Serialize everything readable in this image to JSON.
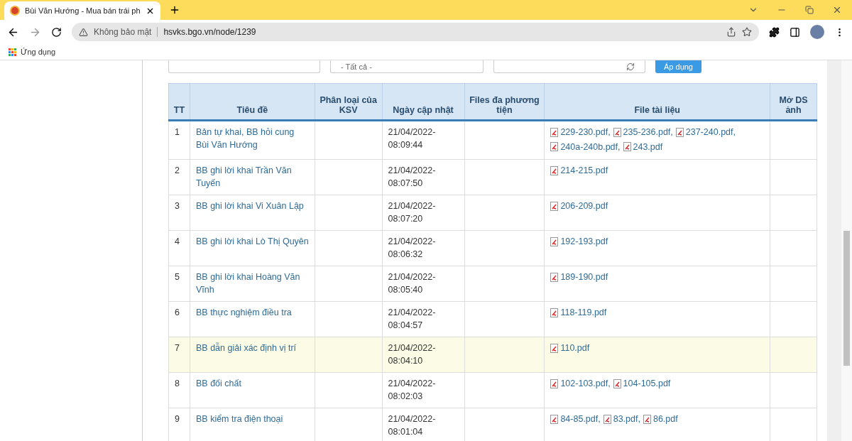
{
  "browser": {
    "tab_title": "Bùi Văn Hướng - Mua bán trái ph",
    "security_label": "Không bảo mật",
    "url": "hsvks.bgo.vn/node/1239",
    "bookmarks": [
      "Ứng dụng"
    ]
  },
  "filters": {
    "select_value": "- Tất cả -",
    "apply_button": "Áp dụng"
  },
  "table": {
    "columns": [
      "TT",
      "Tiêu đề",
      "Phân loại của KSV",
      "Ngày cập nhật",
      "Files đa phương tiện",
      "File tài liệu",
      "Mở DS ảnh"
    ],
    "rows": [
      {
        "tt": "1",
        "title": "Bản tự khai, BB hỏi cung Bùi Văn Hướng",
        "date": "21/04/2022-08:09:44",
        "files": [
          "229-230.pdf,",
          "235-236.pdf,",
          "237-240.pdf,",
          "240a-240b.pdf,",
          "243.pdf"
        ],
        "highlighted": false
      },
      {
        "tt": "2",
        "title": "BB ghi lời khai Trần Văn Tuyến",
        "date": "21/04/2022-08:07:50",
        "files": [
          "214-215.pdf"
        ],
        "highlighted": false
      },
      {
        "tt": "3",
        "title": "BB ghi lời khai Vi Xuân Lập",
        "date": "21/04/2022-08:07:20",
        "files": [
          "206-209.pdf"
        ],
        "highlighted": false
      },
      {
        "tt": "4",
        "title": "BB ghi lời khai Lò Thị Quyên",
        "date": "21/04/2022-08:06:32",
        "files": [
          "192-193.pdf"
        ],
        "highlighted": false
      },
      {
        "tt": "5",
        "title": "BB ghi lời khai Hoàng Văn Vĩnh",
        "date": "21/04/2022-08:05:40",
        "files": [
          "189-190.pdf"
        ],
        "highlighted": false
      },
      {
        "tt": "6",
        "title": "BB thực nghiệm điều tra",
        "date": "21/04/2022-08:04:57",
        "files": [
          "118-119.pdf"
        ],
        "highlighted": false
      },
      {
        "tt": "7",
        "title": "BB dẫn giải xác định vị trí",
        "date": "21/04/2022-08:04:10",
        "files": [
          "110.pdf"
        ],
        "highlighted": true
      },
      {
        "tt": "8",
        "title": "BB đối chất",
        "date": "21/04/2022-08:02:03",
        "files": [
          "102-103.pdf,",
          "104-105.pdf"
        ],
        "highlighted": false
      },
      {
        "tt": "9",
        "title": "BB kiểm tra điện thoại",
        "date": "21/04/2022-08:01:04",
        "files": [
          "84-85.pdf,",
          "83.pdf,",
          "86.pdf"
        ],
        "highlighted": false
      }
    ]
  }
}
